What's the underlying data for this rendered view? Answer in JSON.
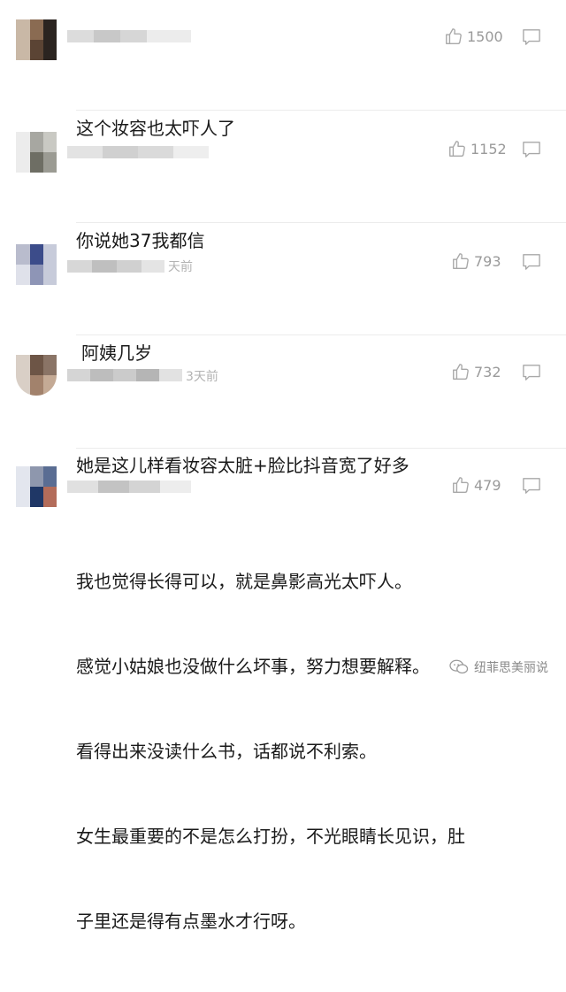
{
  "comments": [
    {
      "time": "",
      "likes": "1500",
      "lines": [
        "这个妆容也太吓人了"
      ]
    },
    {
      "time": "",
      "likes": "1152",
      "lines": [
        "你说她37我都信"
      ]
    },
    {
      "time": "天前",
      "likes": "793",
      "lines": [
        "阿姨几岁"
      ]
    },
    {
      "time": "3天前",
      "likes": "732",
      "lines": [
        "她是这儿样看妆容太脏+脸比抖音宽了好多"
      ]
    },
    {
      "time": "",
      "likes": "479",
      "lines": [
        "我也觉得长得可以，就是鼻影高光太吓人。",
        "感觉小姑娘也没做什么坏事，努力想要解释。",
        "看得出来没读什么书，话都说不利索。",
        "女生最重要的不是怎么打扮，不光眼睛长见识，肚",
        "子里还是得有点墨水才行呀。"
      ]
    }
  ],
  "icons": {
    "like": "thumbs-up-icon",
    "reply": "comment-bubble-icon",
    "watermark": "wechat-icon"
  },
  "watermark": {
    "text": "纽菲思美丽说"
  },
  "colors": {
    "text": "#1a1a1a",
    "meta": "#9a9a9a",
    "divider": "#ececec"
  }
}
